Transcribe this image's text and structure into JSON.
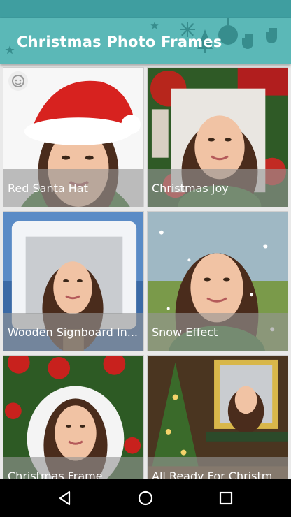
{
  "app_bar": {
    "title": "Christmas Photo Frames",
    "background": "#5bb8b7",
    "status_bar_color": "#3f9ea0"
  },
  "frames": [
    {
      "label": "Red Santa Hat",
      "theme": "red-santa-hat"
    },
    {
      "label": "Christmas Joy",
      "theme": "wreath-frame"
    },
    {
      "label": "Wooden Signboard In...",
      "theme": "snowy-signboard"
    },
    {
      "label": "Snow Effect",
      "theme": "snow-effect"
    },
    {
      "label": "Christmas Frame",
      "theme": "ornament-frame"
    },
    {
      "label": "All Ready For Christm...",
      "theme": "golden-tree-frame"
    }
  ],
  "nav_bar": {
    "back_icon": "back-triangle-icon",
    "home_icon": "home-circle-icon",
    "recents_icon": "recents-square-icon"
  }
}
